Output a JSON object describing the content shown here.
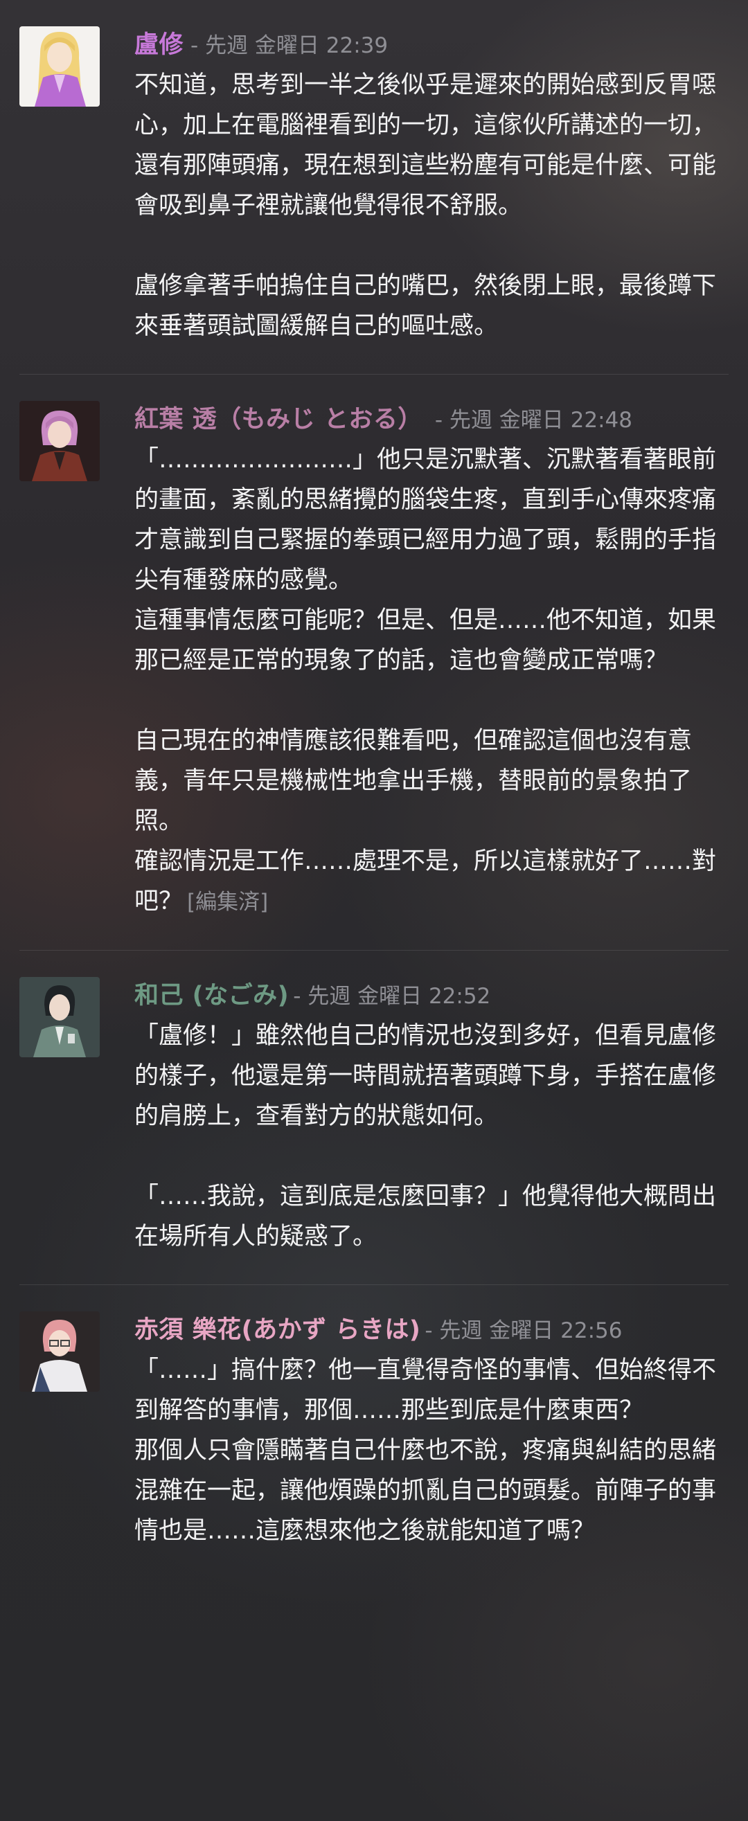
{
  "messages": [
    {
      "author": "盧修",
      "author_color": "#c779d9",
      "sep": "- ",
      "time": "先週 金曜日 22:39",
      "body": "不知道，思考到一半之後似乎是遲來的開始感到反胃噁心，加上在電腦裡看到的一切，這傢伙所講述的一切，還有那陣頭痛，現在想到這些粉塵有可能是什麼、可能會吸到鼻子裡就讓他覺得很不舒服。\n\n盧修拿著手帕摀住自己的嘴巴，然後閉上眼，最後蹲下來垂著頭試圖緩解自己的嘔吐感。",
      "edited": ""
    },
    {
      "author": "紅葉 透（もみじ とおる）",
      "author_color": "#b97fa6",
      "sep": "- ",
      "time": "先週 金曜日 22:48",
      "body": "「……………………」他只是沉默著、沉默著看著眼前的畫面，紊亂的思緒攪的腦袋生疼，直到手心傳來疼痛才意識到自己緊握的拳頭已經用力過了頭，鬆開的手指尖有種發麻的感覺。\n這種事情怎麼可能呢？但是、但是……他不知道，如果那已經是正常的現象了的話，這也會變成正常嗎？\n\n自己現在的神情應該很難看吧，但確認這個也沒有意義，青年只是機械性地拿出手機，替眼前的景象拍了照。\n確認情況是工作……處理不是，所以這樣就好了……對吧？",
      "edited": "[編集済]"
    },
    {
      "author": "和己 (なごみ)",
      "author_color": "#6e9a84",
      "sep": "- ",
      "time": "先週 金曜日 22:52",
      "body": "「盧修！」雖然他自己的情況也沒到多好，但看見盧修的樣子，他還是第一時間就捂著頭蹲下身，手搭在盧修的肩膀上，查看對方的狀態如何。\n\n「……我說，這到底是怎麼回事？」他覺得他大概問出在場所有人的疑惑了。",
      "edited": ""
    },
    {
      "author": "赤須 樂花(あかず らきは)",
      "author_color": "#e8a6c4",
      "sep": "- ",
      "time": "先週 金曜日 22:56",
      "body": "「……」搞什麼？他一直覺得奇怪的事情、但始終得不到解答的事情，那個……那些到底是什麼東西？\n那個人只會隱瞞著自己什麼也不說，疼痛與糾結的思緒混雜在一起，讓他煩躁的抓亂自己的頭髮。前陣子的事情也是……這麼想來他之後就能知道了嗎？",
      "edited": ""
    }
  ]
}
